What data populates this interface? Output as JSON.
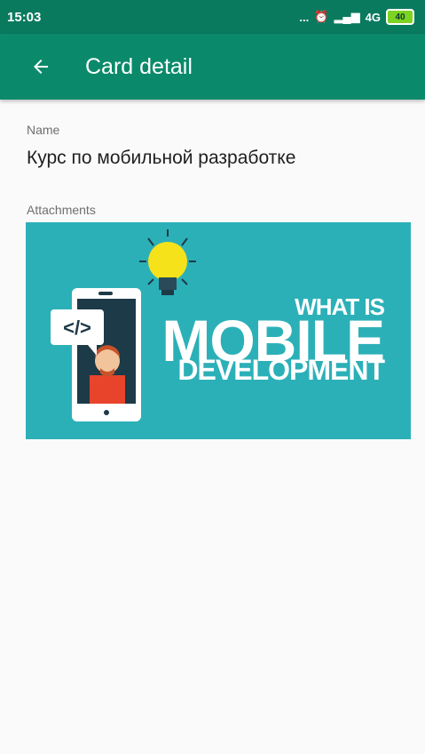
{
  "status_bar": {
    "time": "15:03",
    "signal_text": "... ",
    "network": "4G",
    "battery": "40"
  },
  "app_bar": {
    "back_icon": "arrow-back-icon",
    "title": "Card detail",
    "color": "#0a8a6a"
  },
  "fields": {
    "name_label": "Name",
    "name_value": "Курс по мобильной разработке",
    "attachments_label": "Attachments"
  },
  "attachment": {
    "line1": "WHAT IS",
    "line2": "MOBILE",
    "line3": "DEVELOPMENT",
    "code_tag": "</>",
    "background": "#2cb0b8"
  }
}
